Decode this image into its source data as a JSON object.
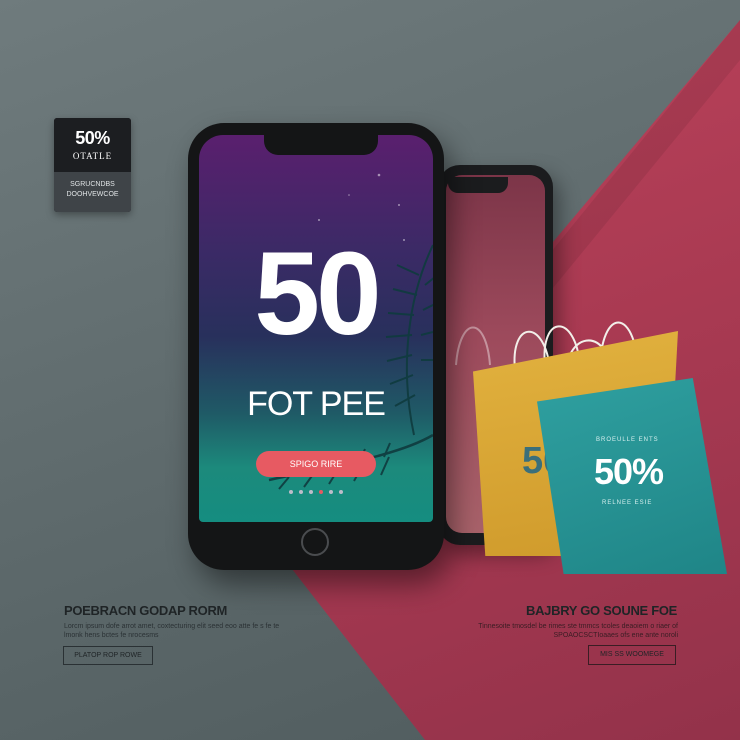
{
  "badge": {
    "percent": "50%",
    "subtitle": "OTATLE",
    "line1": "SGRUCNDBS",
    "line2": "DOOHVEWCOE"
  },
  "phone": {
    "big_number": "50",
    "headline": "FOT PEE",
    "cta": "SPIGO RIRE"
  },
  "bags": {
    "yellow_text": "50",
    "teal_percent": "50%",
    "teal_top": "BROEULLE ENTS",
    "teal_bottom": "RELNEE ESIE"
  },
  "left": {
    "title": "POEBRACN GODAP RORM",
    "text": "Lorcm ipsum dofe arrot amet, coxtecturing elit seed eoo atte fe s fe te lmonk hens bctes fe nrocesms",
    "button": "PLATOP ROP ROWE"
  },
  "right": {
    "title": "BAJBRY GO SOUNE FOE",
    "text": "Tinnesoite tmosdel be rimes ste tmmcs tcoles deaoiem o riaer of SPOAOCSCTIoaaes ofs ene ante noroli",
    "button": "MIS SS WOOMEGE"
  },
  "colors": {
    "red": "#b13f57",
    "grey": "#66727a",
    "teal": "#23908f",
    "yellow": "#d9a836",
    "cta": "#e75a62"
  }
}
